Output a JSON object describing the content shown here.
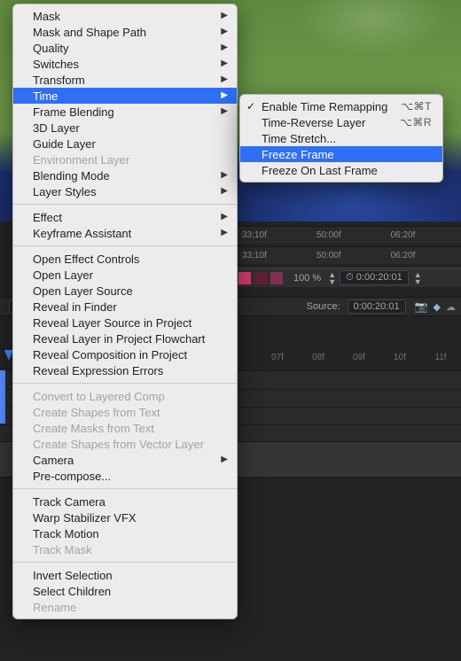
{
  "menu": {
    "groups": [
      [
        {
          "label": "Mask",
          "submenu": true,
          "disabled": false
        },
        {
          "label": "Mask and Shape Path",
          "submenu": true,
          "disabled": false
        },
        {
          "label": "Quality",
          "submenu": true,
          "disabled": false
        },
        {
          "label": "Switches",
          "submenu": true,
          "disabled": false
        },
        {
          "label": "Transform",
          "submenu": true,
          "disabled": false
        },
        {
          "label": "Time",
          "submenu": true,
          "disabled": false,
          "highlight": true
        },
        {
          "label": "Frame Blending",
          "submenu": true,
          "disabled": false
        },
        {
          "label": "3D Layer",
          "submenu": false,
          "disabled": false
        },
        {
          "label": "Guide Layer",
          "submenu": false,
          "disabled": false
        },
        {
          "label": "Environment Layer",
          "submenu": false,
          "disabled": true
        },
        {
          "label": "Blending Mode",
          "submenu": true,
          "disabled": false
        },
        {
          "label": "Layer Styles",
          "submenu": true,
          "disabled": false
        }
      ],
      [
        {
          "label": "Effect",
          "submenu": true,
          "disabled": false
        },
        {
          "label": "Keyframe Assistant",
          "submenu": true,
          "disabled": false
        }
      ],
      [
        {
          "label": "Open Effect Controls",
          "submenu": false,
          "disabled": false
        },
        {
          "label": "Open Layer",
          "submenu": false,
          "disabled": false
        },
        {
          "label": "Open Layer Source",
          "submenu": false,
          "disabled": false
        },
        {
          "label": "Reveal in Finder",
          "submenu": false,
          "disabled": false
        },
        {
          "label": "Reveal Layer Source in Project",
          "submenu": false,
          "disabled": false
        },
        {
          "label": "Reveal Layer in Project Flowchart",
          "submenu": false,
          "disabled": false
        },
        {
          "label": "Reveal Composition in Project",
          "submenu": false,
          "disabled": false
        },
        {
          "label": "Reveal Expression Errors",
          "submenu": false,
          "disabled": false
        }
      ],
      [
        {
          "label": "Convert to Layered Comp",
          "submenu": false,
          "disabled": true
        },
        {
          "label": "Create Shapes from Text",
          "submenu": false,
          "disabled": true
        },
        {
          "label": "Create Masks from Text",
          "submenu": false,
          "disabled": true
        },
        {
          "label": "Create Shapes from Vector Layer",
          "submenu": false,
          "disabled": true
        },
        {
          "label": "Camera",
          "submenu": true,
          "disabled": false
        },
        {
          "label": "Pre-compose...",
          "submenu": false,
          "disabled": false
        }
      ],
      [
        {
          "label": "Track Camera",
          "submenu": false,
          "disabled": false
        },
        {
          "label": "Warp Stabilizer VFX",
          "submenu": false,
          "disabled": false
        },
        {
          "label": "Track Motion",
          "submenu": false,
          "disabled": false
        },
        {
          "label": "Track Mask",
          "submenu": false,
          "disabled": true
        }
      ],
      [
        {
          "label": "Invert Selection",
          "submenu": false,
          "disabled": false
        },
        {
          "label": "Select Children",
          "submenu": false,
          "disabled": false
        },
        {
          "label": "Rename",
          "submenu": false,
          "disabled": true
        }
      ]
    ]
  },
  "time_submenu": [
    {
      "label": "Enable Time Remapping",
      "shortcut": "⌥⌘T",
      "checked": true
    },
    {
      "label": "Time-Reverse Layer",
      "shortcut": "⌥⌘R"
    },
    {
      "label": "Time Stretch..."
    },
    {
      "label": "Freeze Frame",
      "highlight": true
    },
    {
      "label": "Freeze On Last Frame"
    }
  ],
  "ruler1": [
    "33;10f",
    "50:00f",
    "06:20f"
  ],
  "ruler2": [
    "33;10f",
    "50:00f",
    "06:20f"
  ],
  "info_bar": {
    "percent": "100 %",
    "timecode": "0:00:20:01"
  },
  "source_bar": {
    "timecode": "0:00:20:01",
    "source_label": "Source:",
    "source_tc": "0:00:20:01"
  },
  "timeline_ticks": [
    "07f",
    "08f",
    "09f",
    "10f",
    "11f"
  ]
}
